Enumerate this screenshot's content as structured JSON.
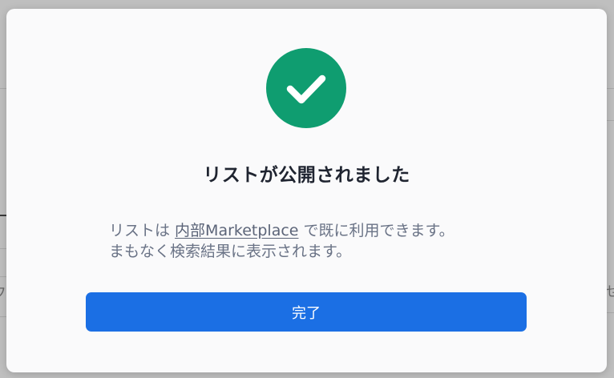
{
  "modal": {
    "title": "リストが公開されました",
    "body": {
      "line1_before": "リストは ",
      "link_text": "内部Marketplace",
      "line1_after": " で既に利用できます。",
      "line2": "まもなく検索結果に表示されます。"
    },
    "done_button_label": "完了"
  },
  "background": {
    "fragment_left": "フ",
    "fragment_right": "せ"
  },
  "colors": {
    "success": "#0f9d70",
    "primary_button": "#1b6fe4",
    "title_text": "#1f2430",
    "body_text": "#6a7386"
  },
  "icons": {
    "status": "check-circle-icon"
  }
}
